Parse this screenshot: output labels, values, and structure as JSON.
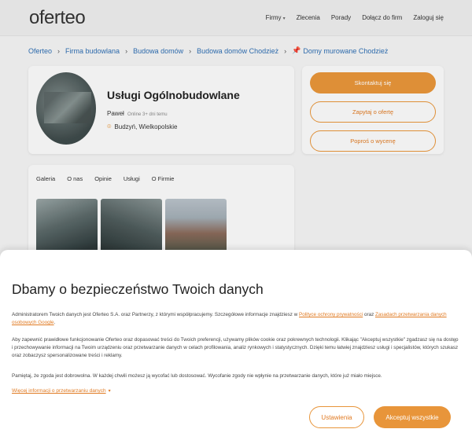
{
  "header": {
    "logo": "oferteo",
    "nav": [
      {
        "label": "Firmy",
        "has_dropdown": true
      },
      {
        "label": "Zlecenia",
        "has_dropdown": false
      },
      {
        "label": "Porady",
        "has_dropdown": false
      },
      {
        "label": "Dołącz do firm",
        "has_dropdown": false
      },
      {
        "label": "Zaloguj się",
        "has_dropdown": false
      }
    ]
  },
  "breadcrumb": [
    "Oferteo",
    "Firma budowlana",
    "Budowa domów",
    "Budowa domów Chodzież",
    "Domy murowane Chodzież"
  ],
  "profile": {
    "title": "Usługi Ogólnobudowlane",
    "person": "Paweł",
    "online": "Online 3+ dni temu",
    "location": "Budzyń, Wielkopolskie"
  },
  "actions": {
    "contact": "Skontaktuj się",
    "ask_offer": "Zapytaj o ofertę",
    "ask_quote": "Poproś o wycenę"
  },
  "gallery": {
    "tabs": [
      "Galeria",
      "O nas",
      "Opinie",
      "Usługi",
      "O Firmie"
    ]
  },
  "consent": {
    "title": "Dbamy o bezpieczeństwo Twoich danych",
    "p1_text": "Administratorem Twoich danych jest Oferteo S.A. oraz Partnerzy, z którymi współpracujemy. Szczegółowe informacje znajdziesz w ",
    "p1_link1": "Polityce ochrony prywatności",
    "p1_mid": " oraz ",
    "p1_link2": "Zasadach przetwarzania danych osobowych Google",
    "p1_end": ".",
    "p2": "Aby zapewnić prawidłowe funkcjonowanie Oferteo oraz dopasować treści do Twoich preferencji, używamy plików cookie oraz pokrewnych technologii. Klikając \"Akceptuj wszystkie\" zgadzasz się na dostęp i przechowywanie informacji na Twoim urządzeniu oraz przetwarzanie danych w celach profilowania, analiz rynkowych i statystycznych. Dzięki temu łatwiej znajdziesz usługi i specjalistów, których szukasz oraz zobaczysz spersonalizowane treści i reklamy.",
    "p3": "Pamiętaj, że zgoda jest dobrowolna. W każdej chwili możesz ją wycofać lub dostosować. Wycofanie zgody nie wpłynie na przetwarzanie danych, które już miało miejsce.",
    "more": "Więcej informacji o przetwarzaniu danych",
    "settings": "Ustawienia",
    "accept": "Akceptuj wszystkie"
  },
  "colors": {
    "accent": "#e8953a",
    "link_blue": "#2f6fb3"
  }
}
